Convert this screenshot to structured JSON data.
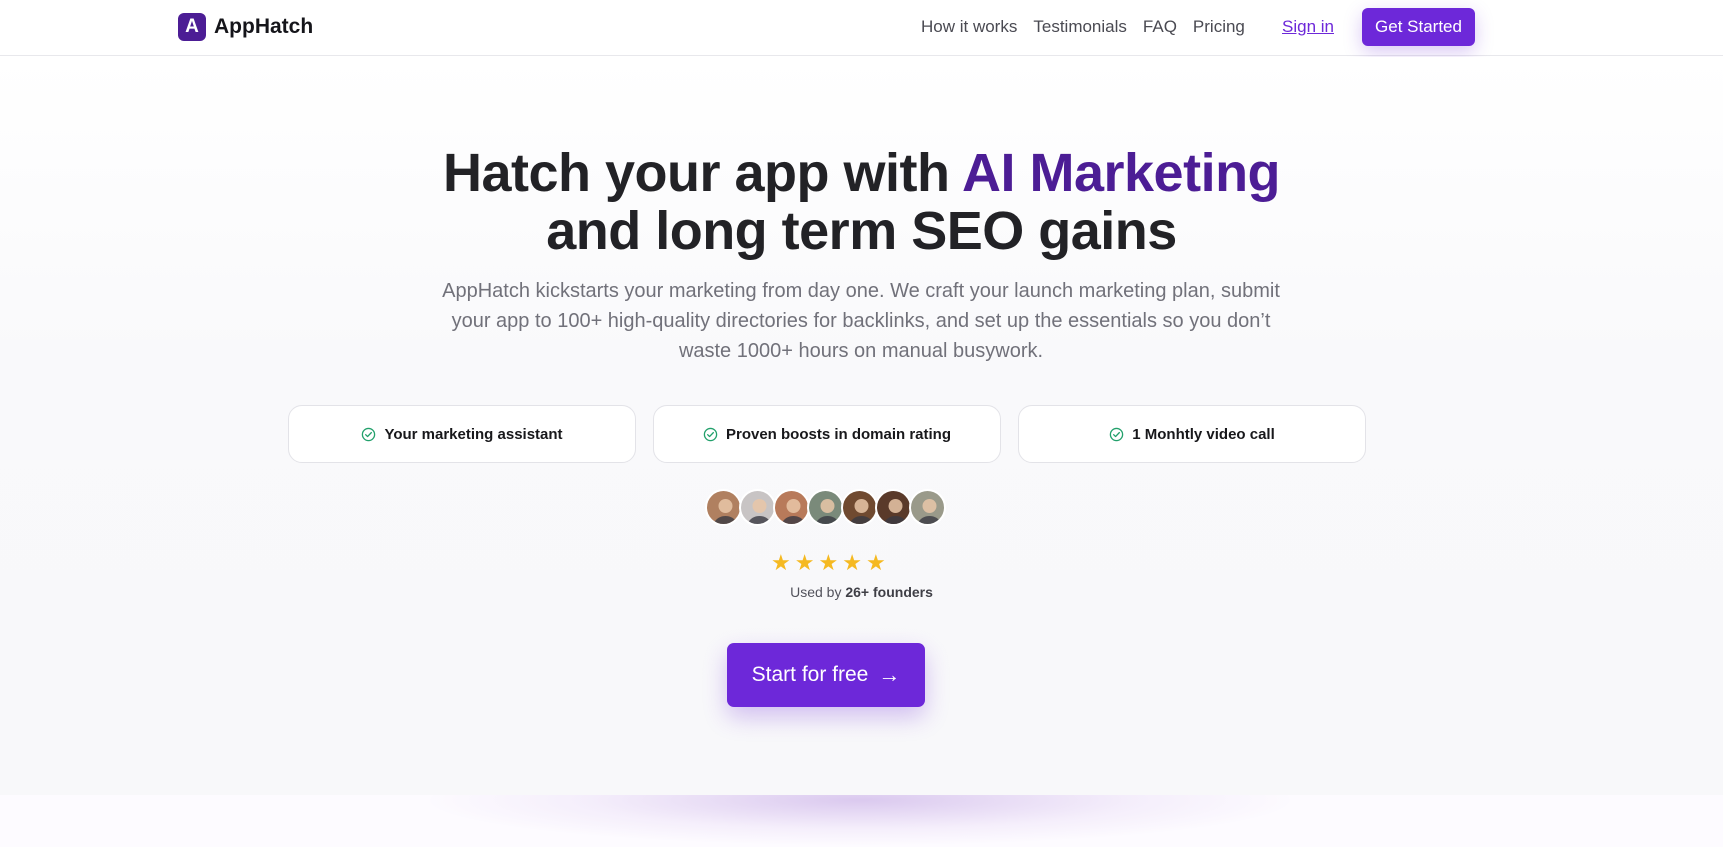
{
  "brand": {
    "logo_letter": "A",
    "name": "AppHatch",
    "accent_color": "#6d28d9",
    "dark_accent": "#4c1d95"
  },
  "nav": {
    "links": [
      "How it works",
      "Testimonials",
      "FAQ",
      "Pricing"
    ],
    "sign_in": "Sign in",
    "get_started": "Get Started"
  },
  "hero": {
    "headline_part1": "Hatch your app with ",
    "headline_accent": "AI Marketing",
    "headline_part2": "and long term SEO gains",
    "subtext": "AppHatch kickstarts your marketing from day one. We craft your launch marketing plan, submit your app to 100+ high-quality directories for backlinks, and set up the essentials so you don’t waste 1000+ hours on manual busywork.",
    "features": [
      "Your marketing assistant",
      "Proven boosts in domain rating",
      "1 Monhtly video call"
    ],
    "avatars": [
      {
        "icon": "founder-avatar",
        "bg": "#b08060"
      },
      {
        "icon": "founder-avatar",
        "bg": "#c8c4c4"
      },
      {
        "icon": "founder-avatar",
        "bg": "#b87a5a"
      },
      {
        "icon": "founder-avatar",
        "bg": "#7a8a7a"
      },
      {
        "icon": "founder-avatar",
        "bg": "#704a30"
      },
      {
        "icon": "founder-avatar",
        "bg": "#5a3a2a"
      },
      {
        "icon": "founder-avatar",
        "bg": "#9a9a8a"
      }
    ],
    "rating_stars": 5,
    "used_by_prefix": "Used by ",
    "used_by_count": "26+ founders",
    "cta_label": "Start for free",
    "cta_icon": "arrow-right-icon"
  }
}
